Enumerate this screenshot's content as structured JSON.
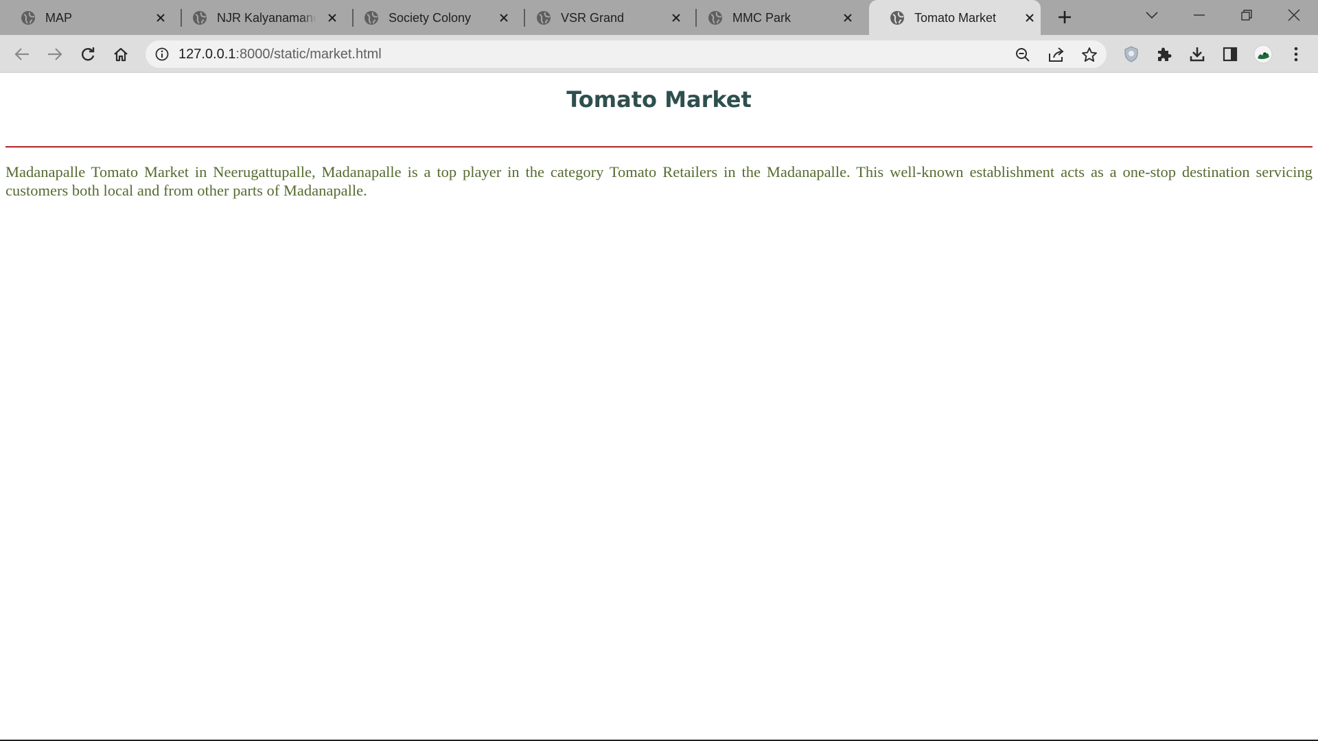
{
  "browser": {
    "tabs": [
      {
        "title": "MAP",
        "active": false
      },
      {
        "title": "NJR Kalyanamandapam",
        "active": false
      },
      {
        "title": "Society Colony",
        "active": false
      },
      {
        "title": "VSR Grand",
        "active": false
      },
      {
        "title": "MMC Park",
        "active": false
      },
      {
        "title": "Tomato Market",
        "active": true
      }
    ],
    "address": {
      "host": "127.0.0.1",
      "path": ":8000/static/market.html"
    }
  },
  "page": {
    "title": "Tomato Market",
    "description": "Madanapalle Tomato Market in Neerugattupalle, Madanapalle is a top player in the category Tomato Retailers in the Madanapalle. This well-known establishment acts as a one-stop destination servicing customers both local and from other parts of Madanapalle."
  },
  "colors": {
    "tabstrip": "#a7a7a7",
    "toolbar": "#dedede",
    "title": "#2f4f4f",
    "divider": "#b22222",
    "text": "#556b2f"
  },
  "icons": {
    "tab_favicon": "globe-icon",
    "tab_close": "close-icon",
    "new_tab": "plus-icon",
    "back": "back-arrow-icon",
    "forward": "forward-arrow-icon",
    "reload": "reload-icon",
    "home": "home-icon",
    "site_info": "info-icon",
    "zoom": "zoom-out-icon",
    "share": "share-icon",
    "bookmark": "star-icon",
    "shield": "shield-icon",
    "extensions": "puzzle-icon",
    "downloads": "download-icon",
    "side_panel": "side-panel-icon",
    "profile": "avatar",
    "menu": "kebab-menu-icon"
  }
}
